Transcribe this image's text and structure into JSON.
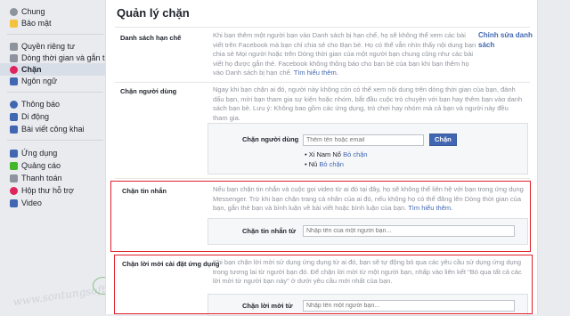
{
  "sidebar": {
    "items": [
      {
        "label": "Chung",
        "icon": "gear-icon",
        "color": "#8d949e"
      },
      {
        "label": "Bảo mật",
        "icon": "lock-shield-icon",
        "color": "#f5c33b"
      },
      {
        "label": "Quyền riêng tư",
        "icon": "privacy-lock-icon",
        "color": "#8d949e"
      },
      {
        "label": "Dòng thời gian và gắn t...",
        "icon": "timeline-icon",
        "color": "#8d949e"
      },
      {
        "label": "Chặn",
        "icon": "block-icon",
        "color": "#e0245e"
      },
      {
        "label": "Ngôn ngữ",
        "icon": "language-icon",
        "color": "#4267b2"
      },
      {
        "label": "Thông báo",
        "icon": "globe-icon",
        "color": "#4267b2"
      },
      {
        "label": "Di động",
        "icon": "mobile-icon",
        "color": "#4267b2"
      },
      {
        "label": "Bài viết công khai",
        "icon": "rss-icon",
        "color": "#4267b2"
      },
      {
        "label": "Ứng dụng",
        "icon": "apps-icon",
        "color": "#4267b2"
      },
      {
        "label": "Quảng cáo",
        "icon": "ads-icon",
        "color": "#42b72a"
      },
      {
        "label": "Thanh toán",
        "icon": "payment-icon",
        "color": "#8d949e"
      },
      {
        "label": "Hộp thư hỗ trợ",
        "icon": "support-icon",
        "color": "#e0245e"
      },
      {
        "label": "Video",
        "icon": "video-icon",
        "color": "#4267b2"
      }
    ]
  },
  "page_title": "Quản lý chặn",
  "sections": {
    "restricted": {
      "label": "Danh sách hạn chế",
      "desc": "Khi bạn thêm một người bạn vào Danh sách bị hạn chế, họ sẽ không thể xem các bài viết trên Facebook mà bạn chỉ chia sẻ cho Bạn bè. Họ có thể vẫn nhìn thấy nội dung bạn chia sẻ Mọi người hoặc trên Dòng thời gian của một người bạn chung cũng như các bài viết họ được gắn thẻ. Facebook không thông báo cho bạn bè của bạn khi bạn thêm họ vào Danh sách bị hạn chế.",
      "link": "Tìm hiểu thêm.",
      "edit": "Chỉnh sửa danh sách"
    },
    "block_users": {
      "label": "Chặn người dùng",
      "desc": "Ngay khi bạn chặn ai đó, người này không còn có thể xem nội dung trên dòng thời gian của bạn, đánh dấu bạn, mời bạn tham gia sự kiện hoặc nhóm, bắt đầu cuộc trò chuyện với bạn hay thêm bạn vào danh sách bạn bè. Lưu ý: Không bao gồm các ứng dụng, trò chơi hay nhóm mà cả bạn và người này đều tham gia.",
      "field_label": "Chặn người dùng",
      "placeholder": "Thêm tên hoặc email",
      "button": "Chặn",
      "blocked": [
        {
          "name": "Xi Nam Nổ",
          "action": "Bỏ chặn"
        },
        {
          "name": "Nû",
          "action": "Bỏ chặn"
        }
      ]
    },
    "block_messages": {
      "label": "Chặn tin nhắn",
      "desc": "Nếu bạn chặn tin nhắn và cuộc gọi video từ ai đó tại đây, họ sẽ không thể liên hệ với bạn trong ứng dụng Messenger. Trừ khi bạn chặn trang cá nhân của ai đó, nếu không họ có thể đăng lên Dòng thời gian của bạn, gắn thẻ bạn và bình luận về bài viết hoặc bình luận của bạn.",
      "link": "Tìm hiểu thêm.",
      "field_label": "Chặn tin nhắn từ",
      "placeholder": "Nhập tên của một người bạn..."
    },
    "block_app_invites": {
      "label": "Chặn lời mời cài đặt ứng dụng",
      "desc": "Khi bạn chặn lời mời sử dụng ứng dụng từ ai đó, bạn sẽ tự động bỏ qua các yêu cầu sử dụng ứng dụng trong tương lai từ người bạn đó. Để chặn lời mời từ một người bạn, nhấp vào liên kết \"Bỏ qua tất cả các lời mời từ người bạn này\" ở dưới yêu cầu mới nhất của bạn.",
      "field_label": "Chặn lời mời từ",
      "placeholder": "Nhập tên một người bạn..."
    }
  },
  "colors": {
    "highlight_box": "#e0202a",
    "link": "#4267b2"
  }
}
